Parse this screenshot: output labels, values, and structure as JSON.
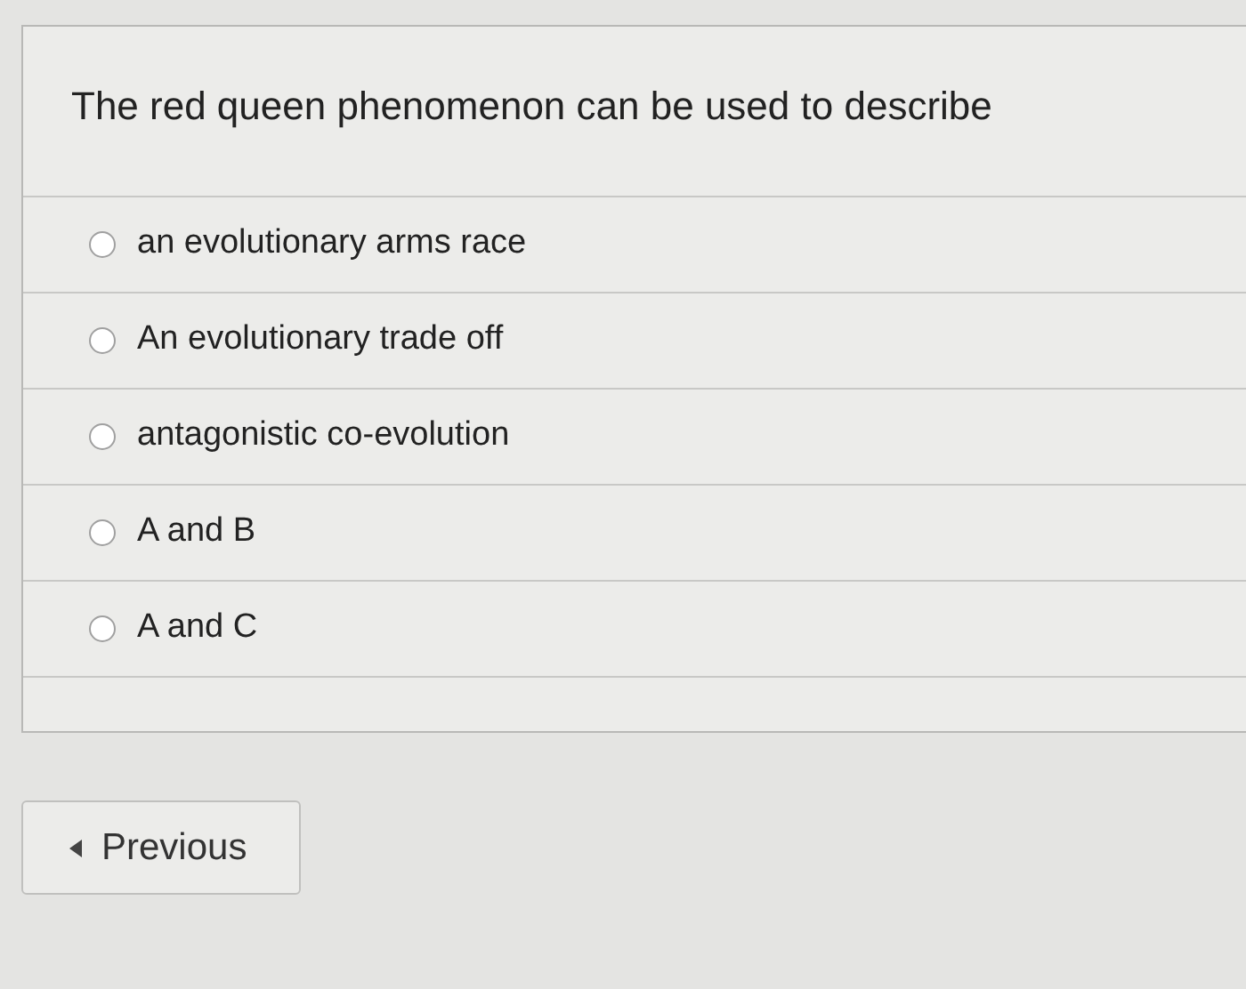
{
  "question": "The red queen phenomenon can be used to describe",
  "options": [
    {
      "label": "an evolutionary arms race",
      "selected": false
    },
    {
      "label": "An evolutionary trade off",
      "selected": false
    },
    {
      "label": "antagonistic co-evolution",
      "selected": false
    },
    {
      "label": "A and B",
      "selected": false
    },
    {
      "label": "A and C",
      "selected": false
    }
  ],
  "previous_button": {
    "label": "Previous"
  }
}
